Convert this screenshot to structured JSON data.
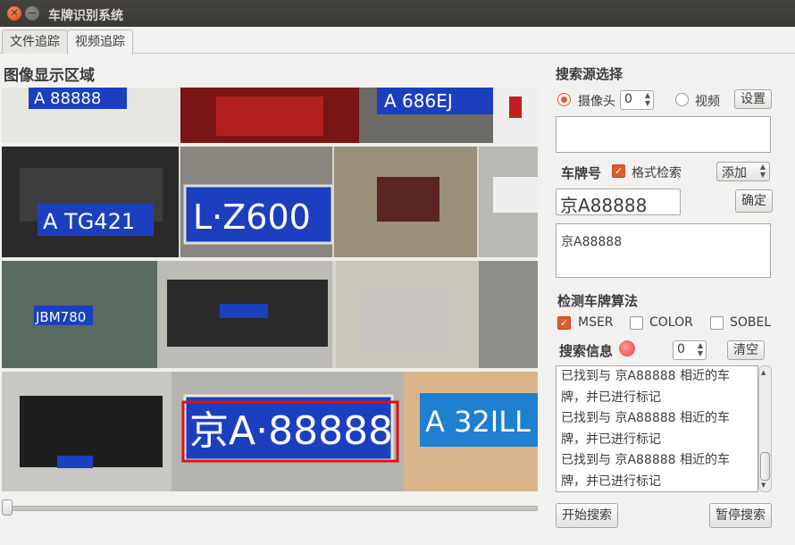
{
  "window": {
    "title": "车牌识别系统"
  },
  "tabs": [
    {
      "label": "文件追踪"
    },
    {
      "label": "视频追踪"
    }
  ],
  "display": {
    "area_title": "图像显示区域",
    "plates": [
      "A 88888",
      "A 686EJ",
      "A TG421",
      "L·Z600",
      "JBM780",
      "A·88888",
      "A 32ILL"
    ],
    "detected_plate": "京A·88888"
  },
  "search_source": {
    "heading": "搜索源选择",
    "camera_label": "摄像头",
    "camera_index": "0",
    "video_label": "视频",
    "settings_button": "设置",
    "source_path": ""
  },
  "plate": {
    "heading": "车牌号",
    "format_check_label": "格式检索",
    "add_combo": "添加",
    "input_value": "京A88888",
    "confirm_button": "确定",
    "list_text": "京A88888"
  },
  "algorithm": {
    "heading": "检测车牌算法",
    "options": [
      {
        "label": "MSER"
      },
      {
        "label": "COLOR"
      },
      {
        "label": "SOBEL"
      }
    ]
  },
  "search_info": {
    "heading": "搜索信息",
    "count": "0",
    "clear_button": "清空",
    "log": [
      "已找到与 京A88888 相近的车",
      "牌，并已进行标记",
      "已找到与 京A88888 相近的车",
      "牌，并已进行标记",
      "已找到与 京A88888 相近的车",
      "牌，并已进行标记"
    ]
  },
  "actions": {
    "start_button": "开始搜索",
    "pause_button": "暂停搜索"
  },
  "colors": {
    "accent": "#e05a2a",
    "plate_blue": "#1f3fbf",
    "highlight_red": "#e01010"
  }
}
